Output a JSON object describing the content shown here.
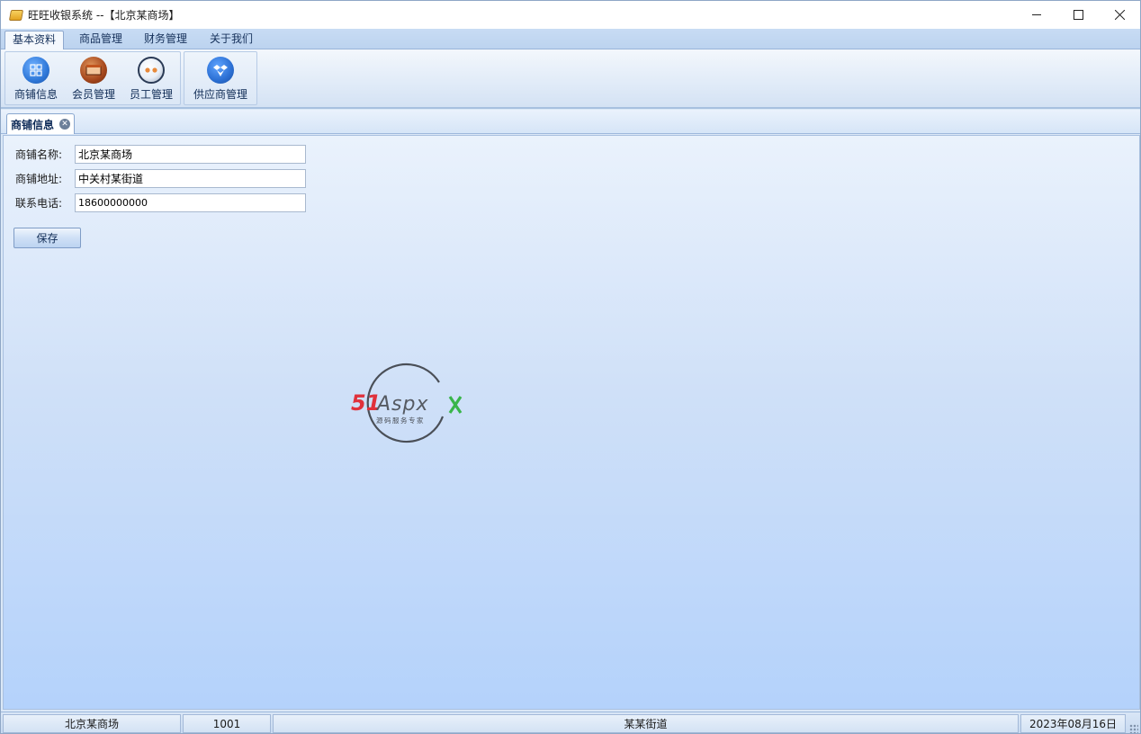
{
  "window": {
    "title": "旺旺收银系统 --【北京某商场】"
  },
  "menu": {
    "items": [
      {
        "label": "基本资料",
        "active": true
      },
      {
        "label": "商品管理",
        "active": false
      },
      {
        "label": "财务管理",
        "active": false
      },
      {
        "label": "关于我们",
        "active": false
      }
    ]
  },
  "ribbon": {
    "buttons": [
      {
        "label": "商铺信息",
        "icon": "store-grid-icon"
      },
      {
        "label": "会员管理",
        "icon": "member-icon"
      },
      {
        "label": "员工管理",
        "icon": "staff-face-icon"
      },
      {
        "label": "供应商管理",
        "icon": "supplier-box-icon"
      }
    ]
  },
  "tabs": [
    {
      "label": "商铺信息",
      "active": true
    }
  ],
  "form": {
    "name_label": "商铺名称:",
    "name_value": "北京某商场",
    "address_label": "商铺地址:",
    "address_value": "中关村某街道",
    "phone_label": "联系电话:",
    "phone_value": "18600000000",
    "save_label": "保存"
  },
  "logo": {
    "brand_51": "51",
    "brand_aspx": "Aspx",
    "tagline": "源码服务专家",
    "colors": {
      "red": "#e0313b",
      "gray": "#555a62",
      "green": "#39b54a"
    }
  },
  "statusbar": {
    "store": "北京某商场",
    "user_id": "1001",
    "address": "某某街道",
    "date": "2023年08月16日"
  },
  "colors": {
    "accent": "#2f78d8",
    "menu_text": "#15305a"
  }
}
